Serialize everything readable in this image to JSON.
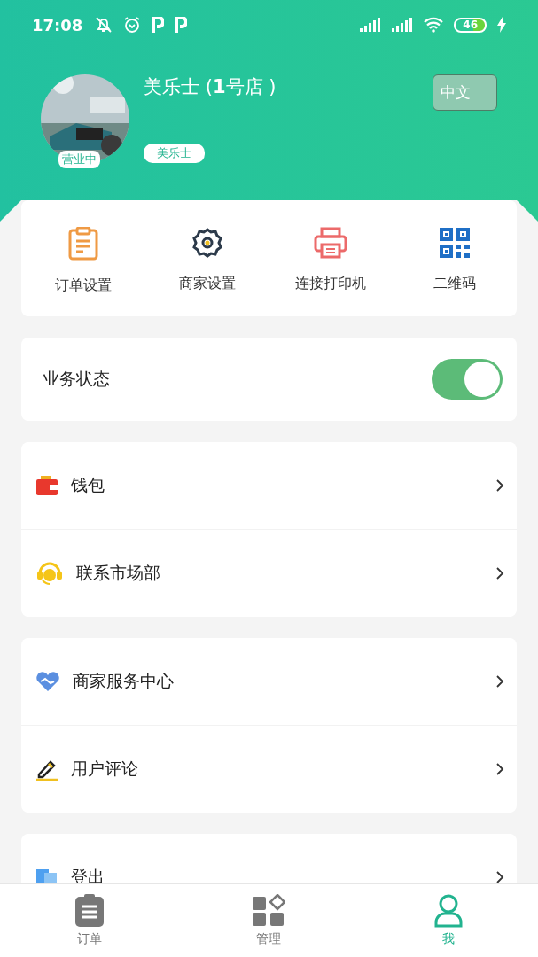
{
  "status_bar": {
    "time": "17:08",
    "battery": "46"
  },
  "profile": {
    "name": "美乐士 (**1**号店 )",
    "open_badge": "营业中",
    "tag": "美乐士",
    "language_button": "中文"
  },
  "shortcuts": [
    {
      "kind": "clipboard",
      "label": "订单设置"
    },
    {
      "kind": "gear",
      "label": "商家设置"
    },
    {
      "kind": "printer",
      "label": "连接打印机"
    },
    {
      "kind": "qr",
      "label": "二维码"
    }
  ],
  "business_status": {
    "label": "业务状态",
    "on": true
  },
  "menu_groups": [
    [
      {
        "kind": "wallet",
        "label": "钱包"
      },
      {
        "kind": "headset",
        "label": "联系市场部"
      }
    ],
    [
      {
        "kind": "handshake",
        "label": "商家服务中心"
      },
      {
        "kind": "pen",
        "label": "用户评论"
      }
    ],
    [
      {
        "kind": "logout",
        "label": "登出"
      }
    ]
  ],
  "tabs": [
    {
      "kind": "orders",
      "label": "订单",
      "selected": false
    },
    {
      "kind": "manage",
      "label": "管理",
      "selected": false
    },
    {
      "kind": "me",
      "label": "我",
      "selected": true
    }
  ]
}
